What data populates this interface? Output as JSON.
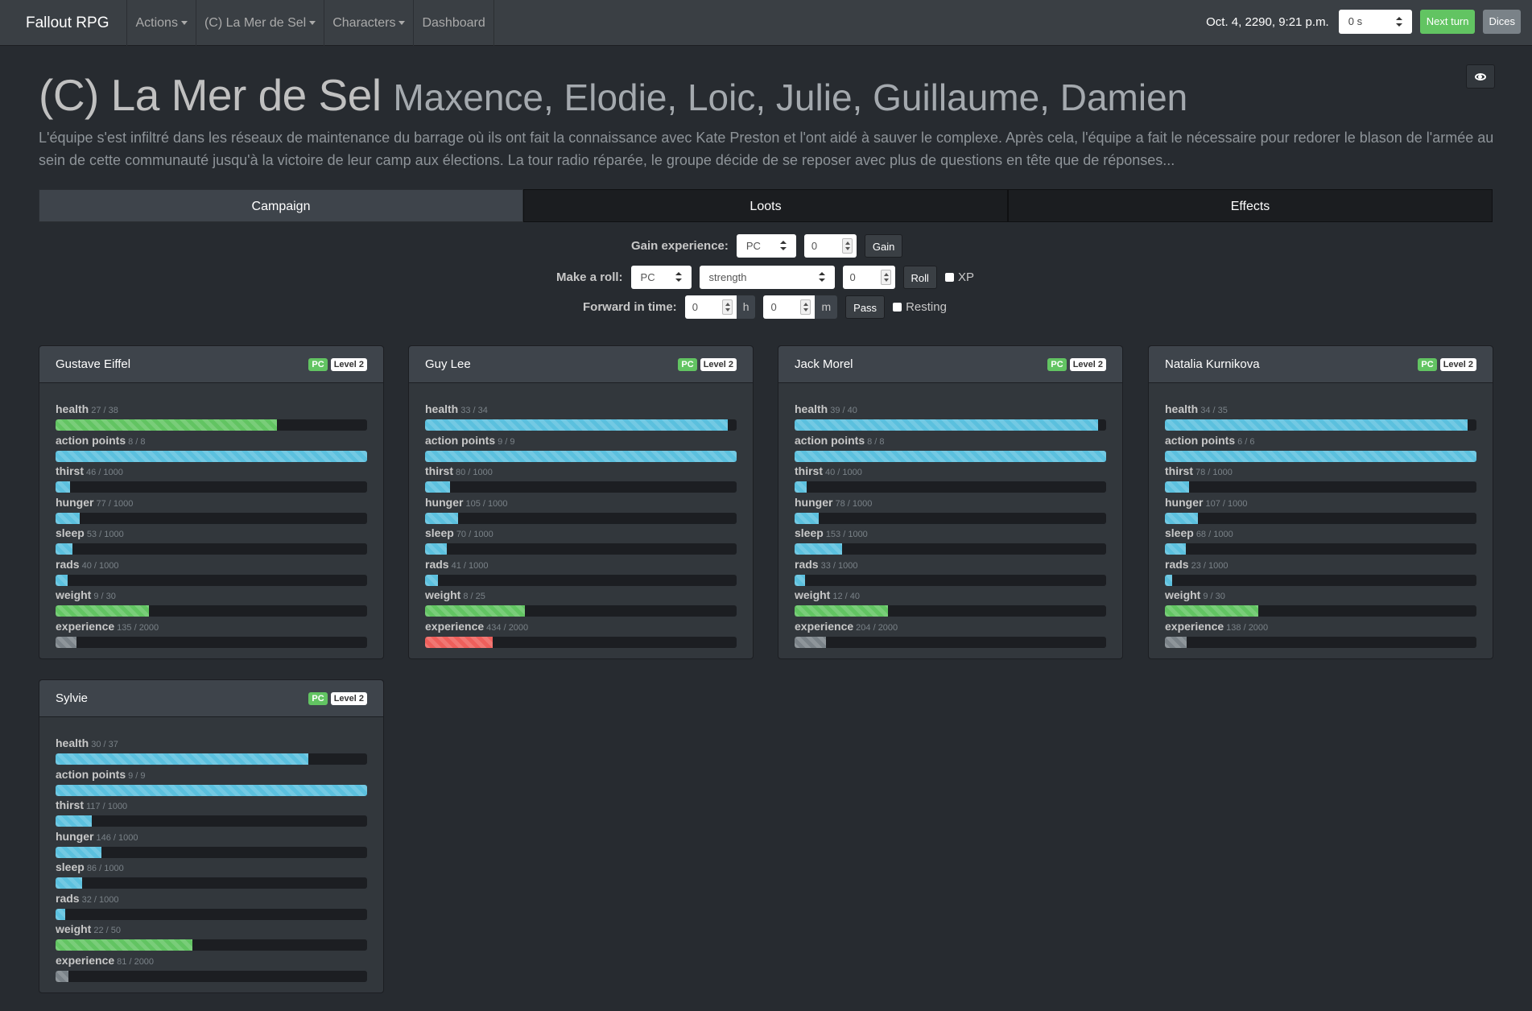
{
  "navbar": {
    "brand": "Fallout RPG",
    "items": [
      {
        "label": "Actions",
        "dropdown": true
      },
      {
        "label": "(C) La Mer de Sel",
        "dropdown": true
      },
      {
        "label": "Characters",
        "dropdown": true
      },
      {
        "label": "Dashboard",
        "dropdown": false
      }
    ],
    "date": "Oct. 4, 2290, 9:21 p.m.",
    "time_select": "0 s",
    "next_turn": "Next turn",
    "dices": "Dices"
  },
  "header": {
    "title": "(C) La Mer de Sel",
    "players": "Maxence, Elodie, Loic, Julie, Guillaume, Damien",
    "description": "L'équipe s'est infiltré dans les réseaux de maintenance du barrage où ils ont fait la connaissance avec Kate Preston et l'ont aidé à sauver le complexe. Après cela, l'équipe a fait le nécessaire pour redorer le blason de l'armée au sein de cette communauté jusqu'à la victoire de leur camp aux élections. La tour radio réparée, le groupe décide de se reposer avec plus de questions en tête que de réponses..."
  },
  "tabs": [
    {
      "label": "Campaign",
      "active": true
    },
    {
      "label": "Loots",
      "active": false
    },
    {
      "label": "Effects",
      "active": false
    }
  ],
  "controls": {
    "gain": {
      "label": "Gain experience:",
      "target": "PC",
      "amount": "0",
      "button": "Gain"
    },
    "roll": {
      "label": "Make a roll:",
      "target": "PC",
      "stat": "strength",
      "modifier": "0",
      "button": "Roll",
      "xp_label": "XP"
    },
    "forward": {
      "label": "Forward in time:",
      "hours": "0",
      "hours_unit": "h",
      "minutes": "0",
      "minutes_unit": "m",
      "button": "Pass",
      "resting_label": "Resting"
    }
  },
  "colors": {
    "blue": "#5bc0de",
    "green": "#62c462",
    "gray": "#7a8288",
    "red": "#ee5f5b"
  },
  "characters": [
    {
      "name": "Gustave Eiffel",
      "badge": "PC",
      "level": "Level 2",
      "stats": [
        {
          "label": "health",
          "value": "27 / 38",
          "fraction": 0.711,
          "color": "green"
        },
        {
          "label": "action points",
          "value": "8 / 8",
          "fraction": 1.0,
          "color": "blue"
        },
        {
          "label": "thirst",
          "value": "46 / 1000",
          "fraction": 0.046,
          "color": "blue"
        },
        {
          "label": "hunger",
          "value": "77 / 1000",
          "fraction": 0.077,
          "color": "blue"
        },
        {
          "label": "sleep",
          "value": "53 / 1000",
          "fraction": 0.053,
          "color": "blue"
        },
        {
          "label": "rads",
          "value": "40 / 1000",
          "fraction": 0.04,
          "color": "blue"
        },
        {
          "label": "weight",
          "value": "9 / 30",
          "fraction": 0.3,
          "color": "green"
        },
        {
          "label": "experience",
          "value": "135 / 2000",
          "fraction": 0.0675,
          "color": "gray"
        }
      ]
    },
    {
      "name": "Guy Lee",
      "badge": "PC",
      "level": "Level 2",
      "stats": [
        {
          "label": "health",
          "value": "33 / 34",
          "fraction": 0.971,
          "color": "blue"
        },
        {
          "label": "action points",
          "value": "9 / 9",
          "fraction": 1.0,
          "color": "blue"
        },
        {
          "label": "thirst",
          "value": "80 / 1000",
          "fraction": 0.08,
          "color": "blue"
        },
        {
          "label": "hunger",
          "value": "105 / 1000",
          "fraction": 0.105,
          "color": "blue"
        },
        {
          "label": "sleep",
          "value": "70 / 1000",
          "fraction": 0.07,
          "color": "blue"
        },
        {
          "label": "rads",
          "value": "41 / 1000",
          "fraction": 0.041,
          "color": "blue"
        },
        {
          "label": "weight",
          "value": "8 / 25",
          "fraction": 0.32,
          "color": "green"
        },
        {
          "label": "experience",
          "value": "434 / 2000",
          "fraction": 0.217,
          "color": "red"
        }
      ]
    },
    {
      "name": "Jack Morel",
      "badge": "PC",
      "level": "Level 2",
      "stats": [
        {
          "label": "health",
          "value": "39 / 40",
          "fraction": 0.975,
          "color": "blue"
        },
        {
          "label": "action points",
          "value": "8 / 8",
          "fraction": 1.0,
          "color": "blue"
        },
        {
          "label": "thirst",
          "value": "40 / 1000",
          "fraction": 0.04,
          "color": "blue"
        },
        {
          "label": "hunger",
          "value": "78 / 1000",
          "fraction": 0.078,
          "color": "blue"
        },
        {
          "label": "sleep",
          "value": "153 / 1000",
          "fraction": 0.153,
          "color": "blue"
        },
        {
          "label": "rads",
          "value": "33 / 1000",
          "fraction": 0.033,
          "color": "blue"
        },
        {
          "label": "weight",
          "value": "12 / 40",
          "fraction": 0.3,
          "color": "green"
        },
        {
          "label": "experience",
          "value": "204 / 2000",
          "fraction": 0.102,
          "color": "gray"
        }
      ]
    },
    {
      "name": "Natalia Kurnikova",
      "badge": "PC",
      "level": "Level 2",
      "stats": [
        {
          "label": "health",
          "value": "34 / 35",
          "fraction": 0.971,
          "color": "blue"
        },
        {
          "label": "action points",
          "value": "6 / 6",
          "fraction": 1.0,
          "color": "blue"
        },
        {
          "label": "thirst",
          "value": "78 / 1000",
          "fraction": 0.078,
          "color": "blue"
        },
        {
          "label": "hunger",
          "value": "107 / 1000",
          "fraction": 0.107,
          "color": "blue"
        },
        {
          "label": "sleep",
          "value": "68 / 1000",
          "fraction": 0.068,
          "color": "blue"
        },
        {
          "label": "rads",
          "value": "23 / 1000",
          "fraction": 0.023,
          "color": "blue"
        },
        {
          "label": "weight",
          "value": "9 / 30",
          "fraction": 0.3,
          "color": "green"
        },
        {
          "label": "experience",
          "value": "138 / 2000",
          "fraction": 0.069,
          "color": "gray"
        }
      ]
    },
    {
      "name": "Sylvie",
      "badge": "PC",
      "level": "Level 2",
      "stats": [
        {
          "label": "health",
          "value": "30 / 37",
          "fraction": 0.811,
          "color": "blue"
        },
        {
          "label": "action points",
          "value": "9 / 9",
          "fraction": 1.0,
          "color": "blue"
        },
        {
          "label": "thirst",
          "value": "117 / 1000",
          "fraction": 0.117,
          "color": "blue"
        },
        {
          "label": "hunger",
          "value": "146 / 1000",
          "fraction": 0.146,
          "color": "blue"
        },
        {
          "label": "sleep",
          "value": "86 / 1000",
          "fraction": 0.086,
          "color": "blue"
        },
        {
          "label": "rads",
          "value": "32 / 1000",
          "fraction": 0.032,
          "color": "blue"
        },
        {
          "label": "weight",
          "value": "22 / 50",
          "fraction": 0.44,
          "color": "green"
        },
        {
          "label": "experience",
          "value": "81 / 2000",
          "fraction": 0.0405,
          "color": "gray"
        }
      ]
    }
  ]
}
